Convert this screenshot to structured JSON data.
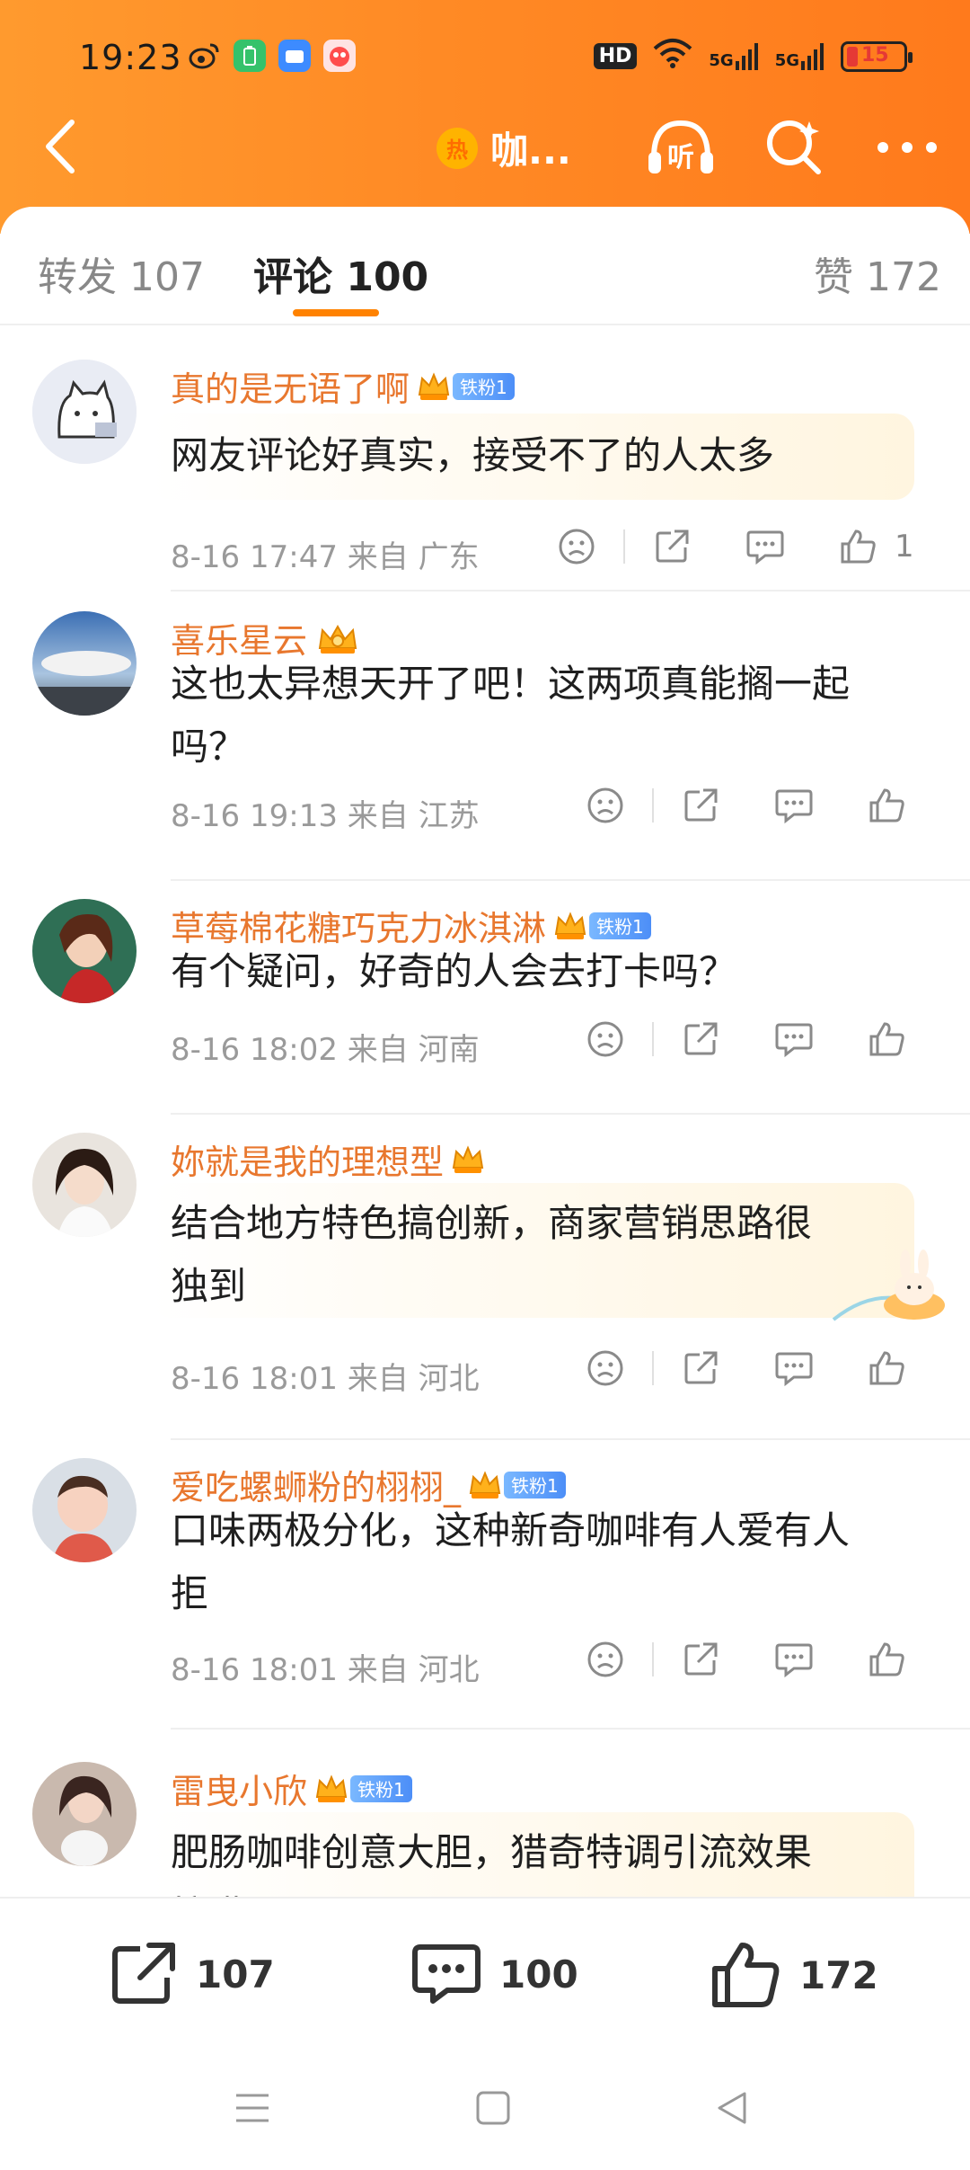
{
  "status_bar": {
    "time": "19:23",
    "hd_label": "HD",
    "network_1": "5G",
    "network_2": "5G",
    "battery": "15"
  },
  "nav": {
    "topic_prefix_icon": "热",
    "topic_title": "咖...",
    "listen_icon_label": "听"
  },
  "tabs": [
    {
      "label": "转发",
      "count": "107"
    },
    {
      "label": "评论",
      "count": "100"
    },
    {
      "label": "赞",
      "count": "172"
    }
  ],
  "comments": [
    {
      "name": "真的是无语了啊",
      "badge": "铁粉1",
      "text_lines": [
        "网友评论好真实，接受不了的人太多"
      ],
      "meta": "8-16 17:47 来自 广东",
      "likes": "1"
    },
    {
      "name": "喜乐星云",
      "badge": "",
      "text_lines": [
        "这也太异想天开了吧！这两项真能搁一起",
        "吗？"
      ],
      "meta": "8-16 19:13 来自 江苏",
      "likes": ""
    },
    {
      "name": "草莓棉花糖巧克力冰淇淋",
      "badge": "铁粉1",
      "text_lines": [
        "有个疑问，好奇的人会去打卡吗？"
      ],
      "meta": "8-16 18:02 来自 河南",
      "likes": ""
    },
    {
      "name": "妳就是我的理想型",
      "badge": "",
      "text_lines": [
        "结合地方特色搞创新，商家营销思路很",
        "独到"
      ],
      "meta": "8-16 18:01 来自 河北",
      "likes": ""
    },
    {
      "name": "爱吃螺蛳粉的栩栩_",
      "badge": "铁粉1",
      "text_lines": [
        "口味两极分化，这种新奇咖啡有人爱有人",
        "拒"
      ],
      "meta": "8-16 18:01 来自 河北",
      "likes": ""
    },
    {
      "name": "雷曳小欣",
      "badge": "铁粉1",
      "text_lines": [
        "肥肠咖啡创意大胆，猎奇特调引流效果",
        "拉满"
      ],
      "meta": "",
      "likes": ""
    }
  ],
  "bottom_bar": {
    "repost_count": "107",
    "comment_count": "100",
    "like_count": "172"
  },
  "colors": {
    "brand_orange": "#ff8a25",
    "username": "#e8772e",
    "tab_underline": "#ff8200"
  }
}
